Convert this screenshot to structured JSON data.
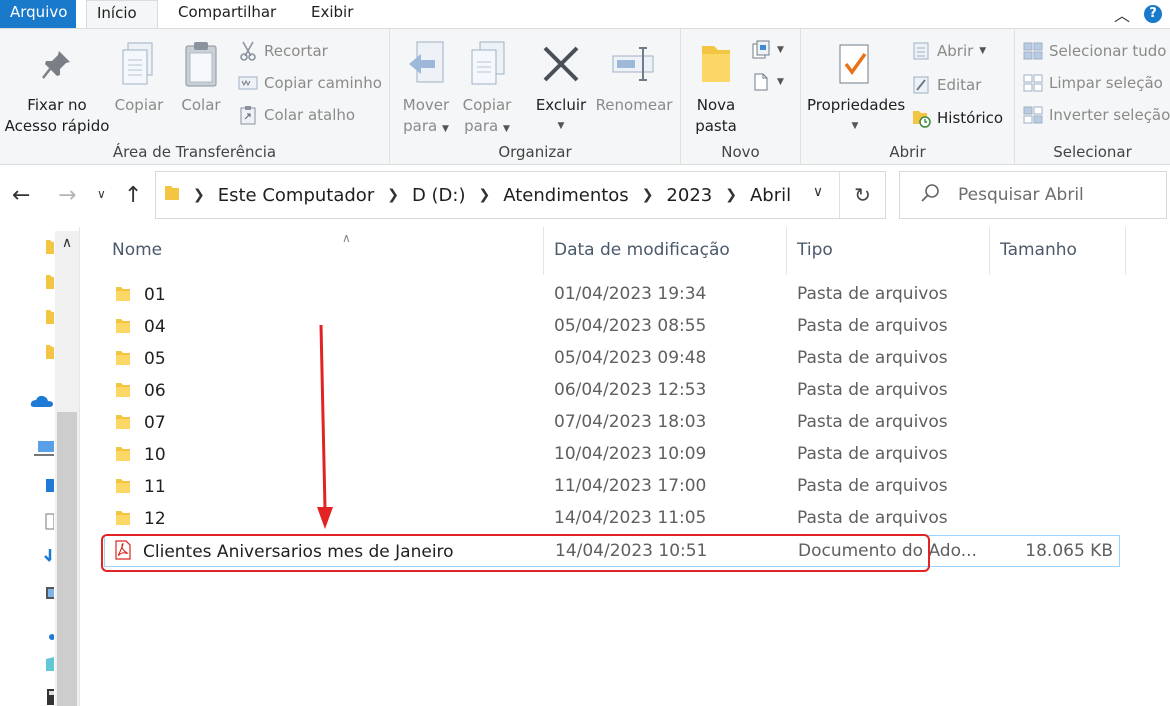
{
  "ribbon_tabs": {
    "file": "Arquivo",
    "home": "Início",
    "share": "Compartilhar",
    "view": "Exibir"
  },
  "clipboard": {
    "pin_line1": "Fixar no",
    "pin_line2": "Acesso rápido",
    "copy": "Copiar",
    "paste": "Colar",
    "cut": "Recortar",
    "copy_path": "Copiar caminho",
    "paste_shortcut": "Colar atalho",
    "label": "Área de Transferência"
  },
  "organize": {
    "move_line1": "Mover",
    "move_line2": "para",
    "copyto_line1": "Copiar",
    "copyto_line2": "para",
    "delete": "Excluir",
    "rename": "Renomear",
    "label": "Organizar"
  },
  "new": {
    "folder_line1": "Nova",
    "folder_line2": "pasta",
    "label": "Novo"
  },
  "open": {
    "properties": "Propriedades",
    "open": "Abrir",
    "edit": "Editar",
    "history": "Histórico",
    "label": "Abrir"
  },
  "select": {
    "all": "Selecionar tudo",
    "none": "Limpar seleção",
    "invert": "Inverter seleção",
    "label": "Selecionar"
  },
  "breadcrumb": [
    "Este Computador",
    "D (D:)",
    "Atendimentos",
    "2023",
    "Abril"
  ],
  "search": {
    "placeholder": "Pesquisar Abril"
  },
  "columns": {
    "name": "Nome",
    "date": "Data de modificação",
    "type": "Tipo",
    "size": "Tamanho"
  },
  "files": [
    {
      "name": "01",
      "date": "01/04/2023 19:34",
      "type": "Pasta de arquivos",
      "size": "",
      "kind": "folder"
    },
    {
      "name": "04",
      "date": "05/04/2023 08:55",
      "type": "Pasta de arquivos",
      "size": "",
      "kind": "folder"
    },
    {
      "name": "05",
      "date": "05/04/2023 09:48",
      "type": "Pasta de arquivos",
      "size": "",
      "kind": "folder"
    },
    {
      "name": "06",
      "date": "06/04/2023 12:53",
      "type": "Pasta de arquivos",
      "size": "",
      "kind": "folder"
    },
    {
      "name": "07",
      "date": "07/04/2023 18:03",
      "type": "Pasta de arquivos",
      "size": "",
      "kind": "folder"
    },
    {
      "name": "10",
      "date": "10/04/2023 10:09",
      "type": "Pasta de arquivos",
      "size": "",
      "kind": "folder"
    },
    {
      "name": "11",
      "date": "11/04/2023 17:00",
      "type": "Pasta de arquivos",
      "size": "",
      "kind": "folder"
    },
    {
      "name": "12",
      "date": "14/04/2023 11:05",
      "type": "Pasta de arquivos",
      "size": "",
      "kind": "folder"
    },
    {
      "name": "Clientes Aniversarios mes de Janeiro",
      "date": "14/04/2023 10:51",
      "type": "Documento do Ado...",
      "size": "18.065 KB",
      "kind": "pdf"
    }
  ],
  "colors": {
    "accent": "#1979ca",
    "folder": "#f4c542",
    "pdf": "#d9251c",
    "highlight": "#e32323"
  }
}
